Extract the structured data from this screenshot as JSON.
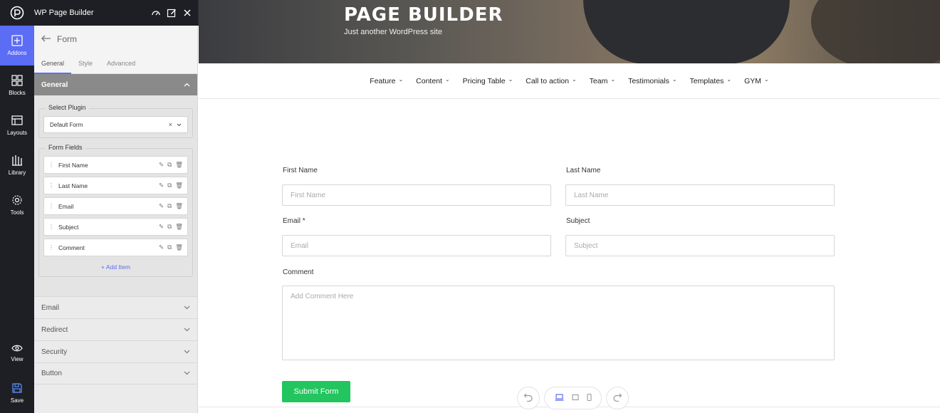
{
  "app": {
    "title": "WP Page Builder"
  },
  "rail": {
    "items": [
      {
        "label": "Addons",
        "icon": "plus-square-icon"
      },
      {
        "label": "Blocks",
        "icon": "blocks-icon"
      },
      {
        "label": "Layouts",
        "icon": "layouts-icon"
      },
      {
        "label": "Library",
        "icon": "library-icon"
      },
      {
        "label": "Tools",
        "icon": "gear-icon"
      }
    ],
    "view_label": "View",
    "save_label": "Save"
  },
  "panel": {
    "title": "Form",
    "tabs": [
      "General",
      "Style",
      "Advanced"
    ],
    "section_title": "General",
    "select_plugin": {
      "label": "Select Plugin",
      "value": "Default Form"
    },
    "form_fields": {
      "label": "Form Fields",
      "items": [
        "First Name",
        "Last Name",
        "Email",
        "Subject",
        "Comment"
      ],
      "add_label": "Add Item"
    },
    "accordions": [
      "Email",
      "Redirect",
      "Security",
      "Button"
    ]
  },
  "site": {
    "title": "PAGE BUILDER",
    "tagline": "Just another WordPress site",
    "nav": [
      "Feature",
      "Content",
      "Pricing Table",
      "Call to action",
      "Team",
      "Testimonials",
      "Templates",
      "GYM"
    ]
  },
  "form": {
    "first_name": {
      "label": "First Name",
      "placeholder": "First Name"
    },
    "last_name": {
      "label": "Last Name",
      "placeholder": "Last Name"
    },
    "email": {
      "label": "Email *",
      "placeholder": "Email"
    },
    "subject": {
      "label": "Subject",
      "placeholder": "Subject"
    },
    "comment": {
      "label": "Comment",
      "placeholder": "Add Comment Here"
    },
    "submit_label": "Submit Form"
  },
  "colors": {
    "accent": "#5b6cf5",
    "submit": "#22c55e",
    "sidebar_bg": "#1e1f24"
  }
}
